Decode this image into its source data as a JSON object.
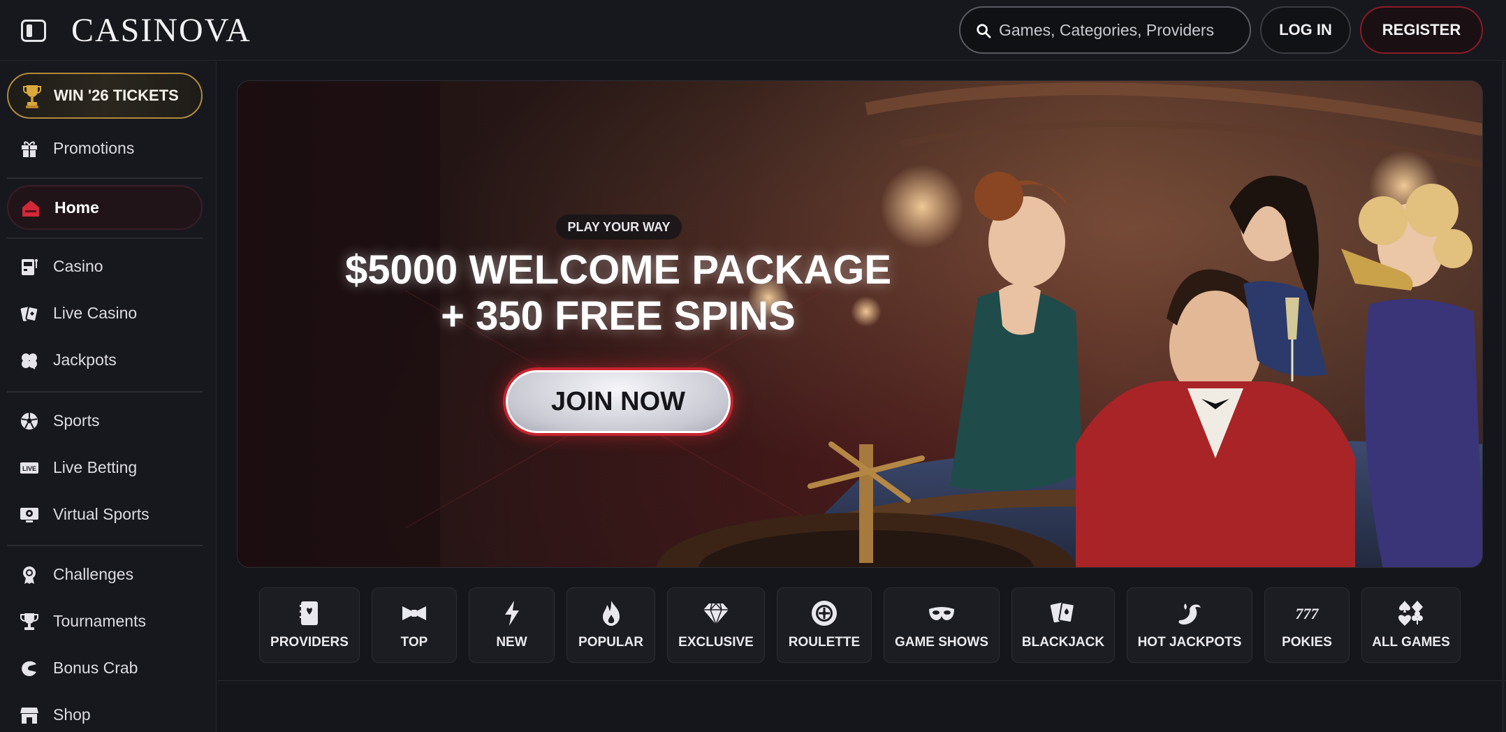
{
  "header": {
    "logo": "CASINOVA",
    "search_placeholder": "Games, Categories, Providers",
    "login_label": "LOG IN",
    "register_label": "REGISTER"
  },
  "sidebar": {
    "tickets_label": "WIN '26 TICKETS",
    "items": [
      {
        "label": "Promotions",
        "icon": "gift-icon"
      },
      {
        "label": "Home",
        "icon": "home-icon",
        "active": true
      },
      {
        "label": "Casino",
        "icon": "slot-machine-icon"
      },
      {
        "label": "Live Casino",
        "icon": "cards-icon"
      },
      {
        "label": "Jackpots",
        "icon": "clover-icon"
      },
      {
        "label": "Sports",
        "icon": "soccer-ball-icon"
      },
      {
        "label": "Live Betting",
        "icon": "live-icon"
      },
      {
        "label": "Virtual Sports",
        "icon": "virtual-screen-icon"
      },
      {
        "label": "Challenges",
        "icon": "medal-icon"
      },
      {
        "label": "Tournaments",
        "icon": "trophy-icon"
      },
      {
        "label": "Bonus Crab",
        "icon": "crab-claw-icon"
      },
      {
        "label": "Shop",
        "icon": "shop-icon"
      }
    ]
  },
  "hero": {
    "tag": "PLAY YOUR WAY",
    "title_line1": "$5000 WELCOME PACKAGE",
    "title_line2": "+ 350 FREE SPINS",
    "cta": "JOIN NOW"
  },
  "categories": [
    {
      "label": "PROVIDERS",
      "icon": "book-icon"
    },
    {
      "label": "TOP",
      "icon": "bowtie-icon"
    },
    {
      "label": "NEW",
      "icon": "lightning-icon"
    },
    {
      "label": "POPULAR",
      "icon": "flame-icon"
    },
    {
      "label": "EXCLUSIVE",
      "icon": "diamond-icon"
    },
    {
      "label": "ROULETTE",
      "icon": "roulette-icon"
    },
    {
      "label": "GAME SHOWS",
      "icon": "mask-icon"
    },
    {
      "label": "BLACKJACK",
      "icon": "playing-cards-icon"
    },
    {
      "label": "HOT JACKPOTS",
      "icon": "chili-icon"
    },
    {
      "label": "POKIES",
      "icon": "sevens-icon"
    },
    {
      "label": "ALL GAMES",
      "icon": "suits-icon"
    }
  ],
  "colors": {
    "background": "#15161b",
    "accent_red": "#c5242f",
    "gold": "#b08a3a"
  }
}
